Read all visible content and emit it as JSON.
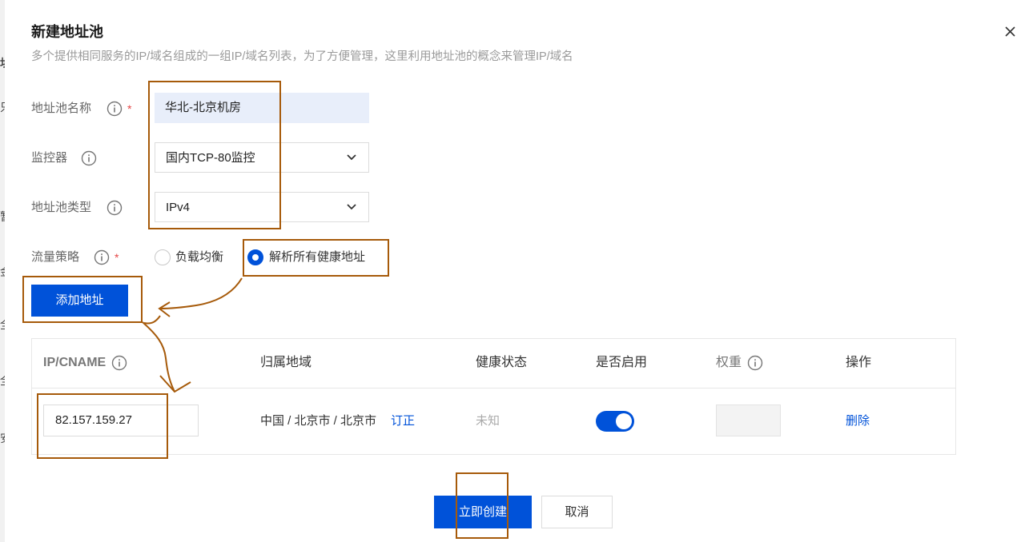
{
  "background_partial_chars": [
    "址",
    "只",
    "暂",
    "金",
    "全",
    "全",
    "安"
  ],
  "dialog": {
    "title": "新建地址池",
    "subtitle": "多个提供相同服务的IP/域名组成的一组IP/域名列表，为了方便管理，这里利用地址池的概念来管理IP/域名",
    "close_icon": "close-icon"
  },
  "form": {
    "pool_name": {
      "label": "地址池名称",
      "required_mark": "*",
      "value": "华北-北京机房"
    },
    "monitor": {
      "label": "监控器",
      "selected": "国内TCP-80监控"
    },
    "pool_type": {
      "label": "地址池类型",
      "selected": "IPv4"
    },
    "traffic_policy": {
      "label": "流量策略",
      "required_mark": "*",
      "options": [
        {
          "label": "负载均衡",
          "selected": false
        },
        {
          "label": "解析所有健康地址",
          "selected": true
        }
      ]
    },
    "add_address_label": "添加地址"
  },
  "table": {
    "headers": [
      "IP/CNAME",
      "归属地域",
      "健康状态",
      "是否启用",
      "权重",
      "操作"
    ],
    "rows": [
      {
        "ip": "82.157.159.27",
        "region": "中国 / 北京市 / 北京市",
        "region_action": "订正",
        "health": "未知",
        "enabled": true,
        "weight": "",
        "action": "删除"
      }
    ]
  },
  "footer": {
    "create_label": "立即创建",
    "cancel_label": "取消"
  },
  "colors": {
    "primary": "#0052d9",
    "annotation": "#a65a0a",
    "required": "#e54545",
    "input_fill": "#e8eefa"
  }
}
